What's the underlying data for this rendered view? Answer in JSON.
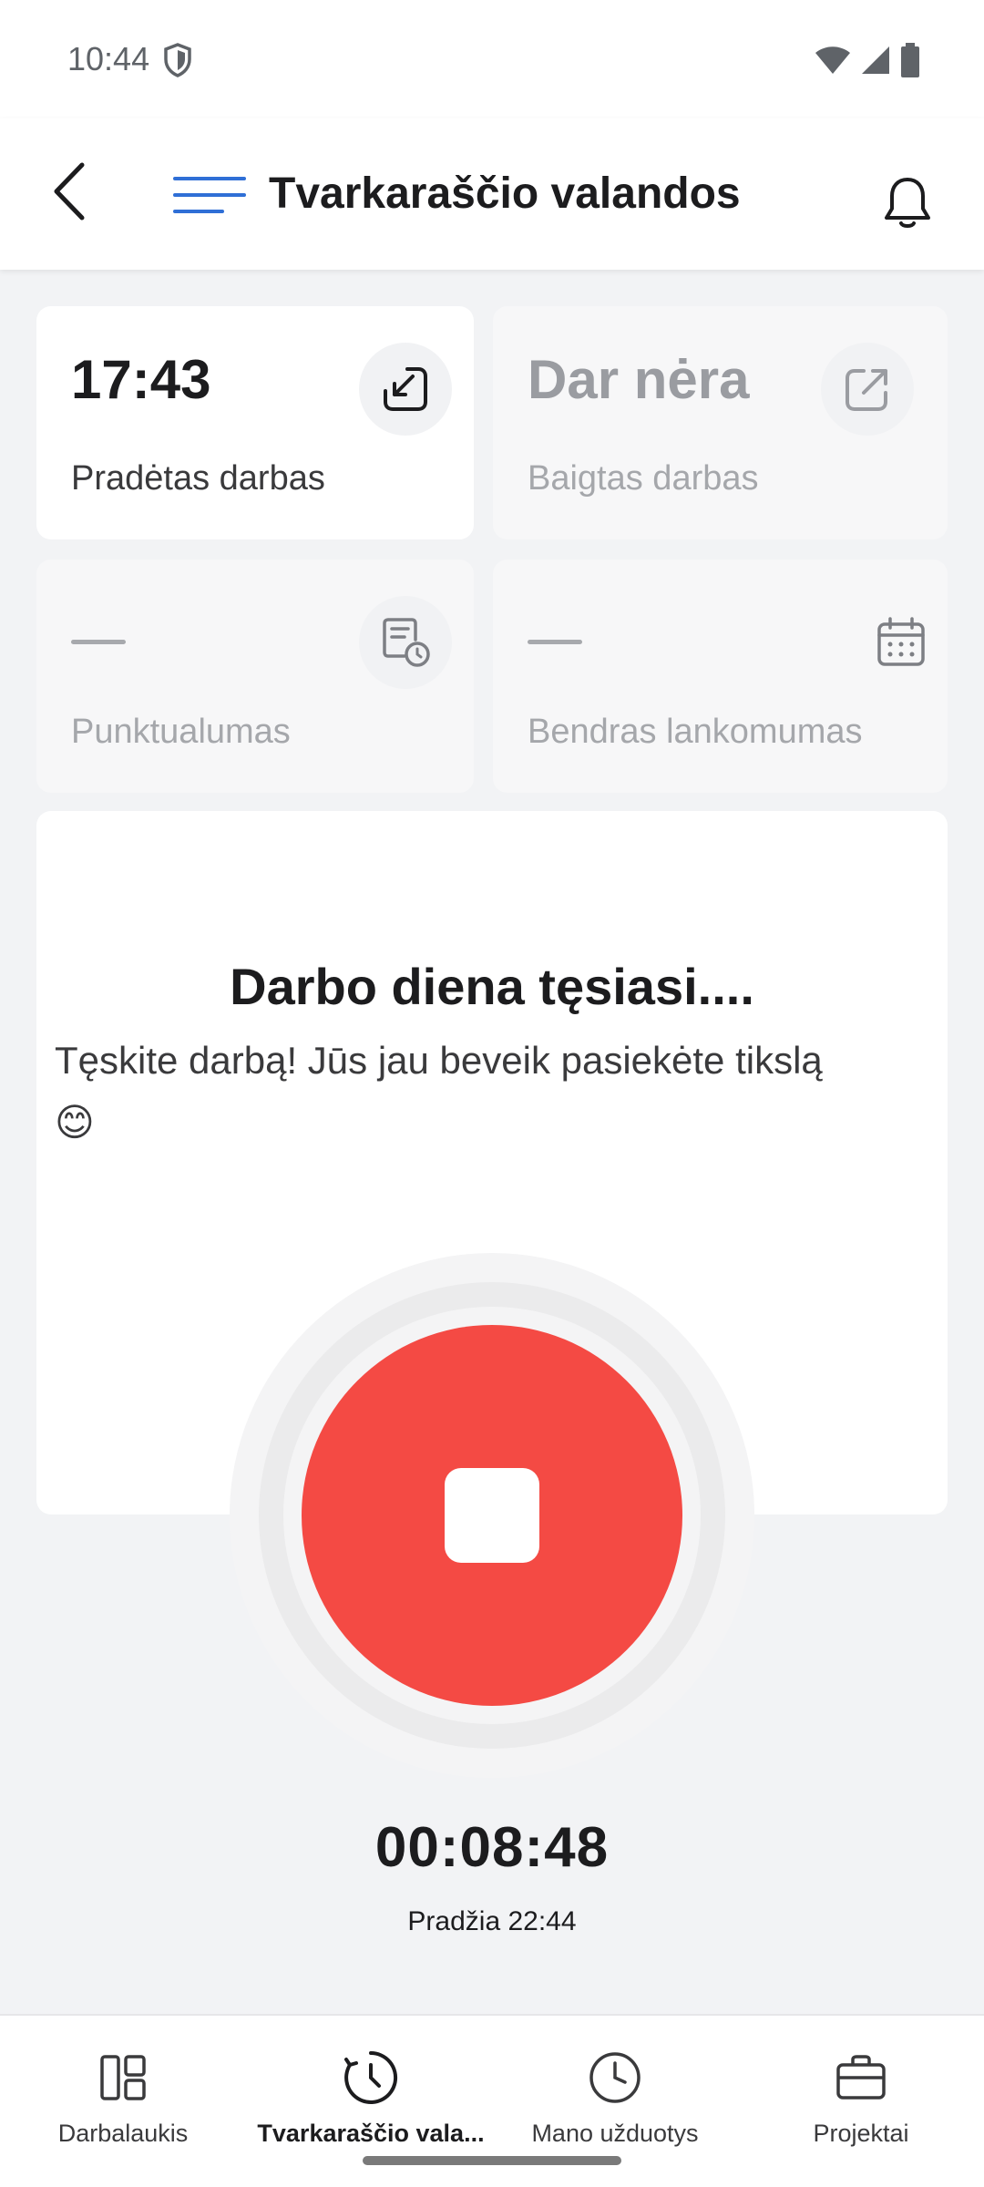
{
  "status_bar": {
    "time": "10:44"
  },
  "header": {
    "title": "Tvarkaraščio valandos"
  },
  "cards": [
    {
      "value": "17:43",
      "label": "Pradėtas darbas",
      "icon": "clock-in-icon"
    },
    {
      "value": "Dar nėra",
      "label": "Baigtas darbas",
      "icon": "clock-out-icon"
    },
    {
      "value": "",
      "label": "Punktualumas",
      "icon": "punctuality-icon"
    },
    {
      "value": "",
      "label": "Bendras lankomumas",
      "icon": "calendar-icon"
    }
  ],
  "panel": {
    "title": "Darbo diena tęsiasi....",
    "subtitle": "Tęskite darbą! Jūs jau beveik pasiekėte tikslą",
    "emoji": "😊"
  },
  "timer": {
    "elapsed": "00:08:48",
    "start": "Pradžia 22:44"
  },
  "bottom_nav": [
    {
      "label": "Darbalaukis",
      "icon": "dashboard-icon",
      "active": false
    },
    {
      "label": "Tvarkaraščio vala...",
      "icon": "timesheet-icon",
      "active": true
    },
    {
      "label": "Mano užduotys",
      "icon": "clock-icon",
      "active": false
    },
    {
      "label": "Projektai",
      "icon": "briefcase-icon",
      "active": false
    }
  ],
  "colors": {
    "stop": "#f44a44",
    "menu_accent": "#2f6fd6"
  }
}
